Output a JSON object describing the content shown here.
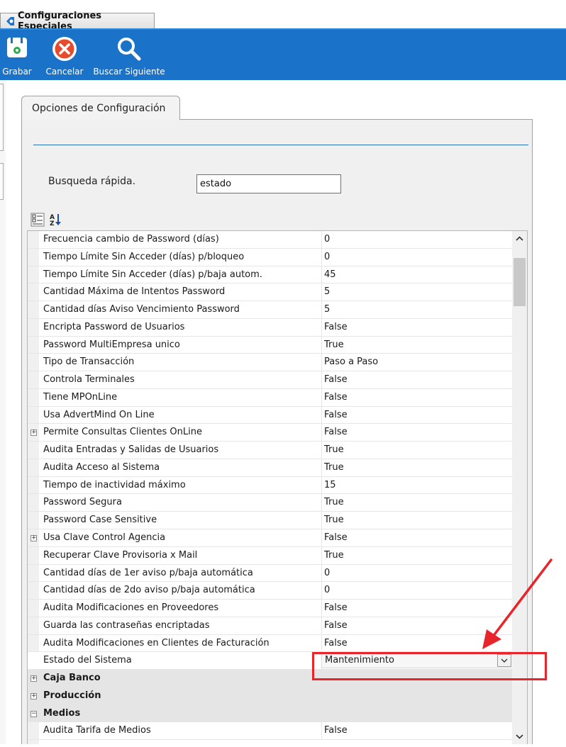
{
  "window": {
    "tab_title": "Configuraciones Especiales"
  },
  "toolbar": {
    "buttons": [
      {
        "label": "Grabar",
        "icon": "save-icon"
      },
      {
        "label": "Cancelar",
        "icon": "cancel-icon"
      },
      {
        "label": "Buscar Siguiente",
        "icon": "search-icon"
      }
    ],
    "background": "#1a73c8"
  },
  "panel": {
    "tab_label": "Opciones de Configuración"
  },
  "search": {
    "label": "Busqueda rápida.",
    "value": "estado"
  },
  "grid": {
    "rows": [
      {
        "name": "Frecuencia cambio de Password (días)",
        "value": "0"
      },
      {
        "name": "Tiempo Límite Sin Acceder (días) p/bloqueo",
        "value": "0"
      },
      {
        "name": "Tiempo Límite Sin Acceder (días) p/baja autom.",
        "value": "45"
      },
      {
        "name": "Cantidad Máxima de Intentos Password",
        "value": "5"
      },
      {
        "name": "Cantidad días Aviso Vencimiento Password",
        "value": "5"
      },
      {
        "name": "Encripta Password de Usuarios",
        "value": "False"
      },
      {
        "name": "Password MultiEmpresa unico",
        "value": "True"
      },
      {
        "name": "Tipo de Transacción",
        "value": "Paso a Paso"
      },
      {
        "name": "Controla Terminales",
        "value": "False"
      },
      {
        "name": "Tiene MPOnLine",
        "value": "False"
      },
      {
        "name": "Usa AdvertMind On Line",
        "value": "False"
      },
      {
        "name": "Permite Consultas Clientes OnLine",
        "value": "False",
        "expander": "+"
      },
      {
        "name": "Audita Entradas y Salidas de Usuarios",
        "value": "True"
      },
      {
        "name": "Audita Acceso al Sistema",
        "value": "True"
      },
      {
        "name": "Tiempo de inactividad máximo",
        "value": "15"
      },
      {
        "name": "Password Segura",
        "value": "True"
      },
      {
        "name": "Password Case Sensitive",
        "value": "True"
      },
      {
        "name": "Usa Clave Control Agencia",
        "value": "False",
        "expander": "+"
      },
      {
        "name": "Recuperar Clave Provisoria x Mail",
        "value": "True"
      },
      {
        "name": "Cantidad días de 1er aviso p/baja automática",
        "value": "0"
      },
      {
        "name": "Cantidad días de 2do aviso p/baja automática",
        "value": "0"
      },
      {
        "name": "Audita Modificaciones en Proveedores",
        "value": "False"
      },
      {
        "name": "Guarda las contraseñas encriptadas",
        "value": "False"
      },
      {
        "name": "Audita Modificaciones en Clientes de Facturación",
        "value": "False"
      },
      {
        "name": "Estado del Sistema",
        "value": "Mantenimiento",
        "dropdown": true
      },
      {
        "name": "Caja Banco",
        "value": "",
        "category": true,
        "expander": "+"
      },
      {
        "name": "Producción",
        "value": "",
        "category": true,
        "expander": "+"
      },
      {
        "name": "Medios",
        "value": "",
        "category": true,
        "expander": "−"
      },
      {
        "name": "Audita Tarifa de Medios",
        "value": "False"
      }
    ]
  },
  "annotation": {
    "color": "#e8252a"
  }
}
